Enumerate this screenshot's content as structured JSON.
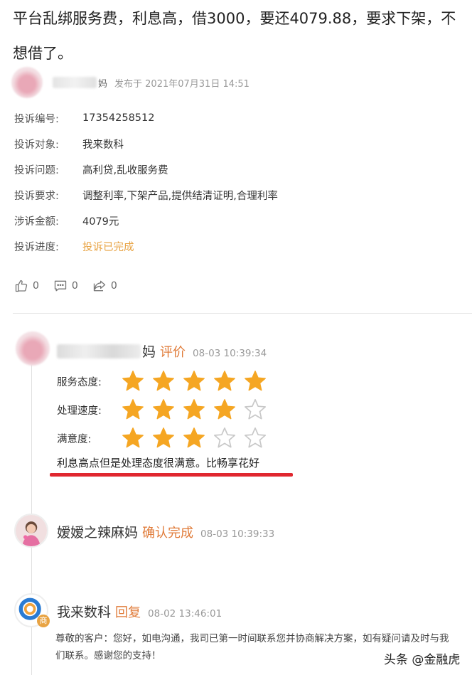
{
  "post": {
    "title": "平台乱绑服务费，利息高，借3000，要还4079.88，要求下架，不想借了。",
    "author_tail": "妈",
    "posted_at": "发布于 2021年07月31日 14:51"
  },
  "info": [
    {
      "label": "投诉编号:",
      "value": "17354258512"
    },
    {
      "label": "投诉对象:",
      "value": "我来数科"
    },
    {
      "label": "投诉问题:",
      "value": "高利贷,乱收服务费"
    },
    {
      "label": "投诉要求:",
      "value": "调整利率,下架产品,提供结清证明,合理利率"
    },
    {
      "label": "涉诉金额:",
      "value": "4079元"
    },
    {
      "label": "投诉进度:",
      "value": "投诉已完成"
    }
  ],
  "actions": {
    "like_count": "0",
    "comment_count": "0",
    "share_count": "0"
  },
  "timeline": {
    "review": {
      "name_tail": "妈",
      "action": "评价",
      "time": "08-03 10:39:34",
      "ratings": [
        {
          "label": "服务态度:",
          "stars": 5,
          "max": 5
        },
        {
          "label": "处理速度:",
          "stars": 4,
          "max": 5
        },
        {
          "label": "满意度:",
          "stars": 3,
          "max": 5
        }
      ],
      "comment": "利息高点但是处理态度很满意。比畅享花好"
    },
    "confirm": {
      "name": "嫒嫒之辣麻妈",
      "action": "确认完成",
      "time": "08-03 10:39:33"
    },
    "reply": {
      "name": "我来数科",
      "action": "回复",
      "time": "08-02 13:46:01",
      "badge": "商",
      "text": "尊敬的客户：您好，如电沟通，我司已第一时间联系您并协商解决方案，如有疑问请及时与我们联系。感谢您的支持！"
    }
  },
  "watermark": "头条 @金融虎",
  "colors": {
    "star_filled": "#f5a623",
    "star_empty": "#c8c8c8",
    "action_orange": "#e07b39",
    "progress_done": "#e8a343",
    "underline_red": "#e0272f"
  }
}
